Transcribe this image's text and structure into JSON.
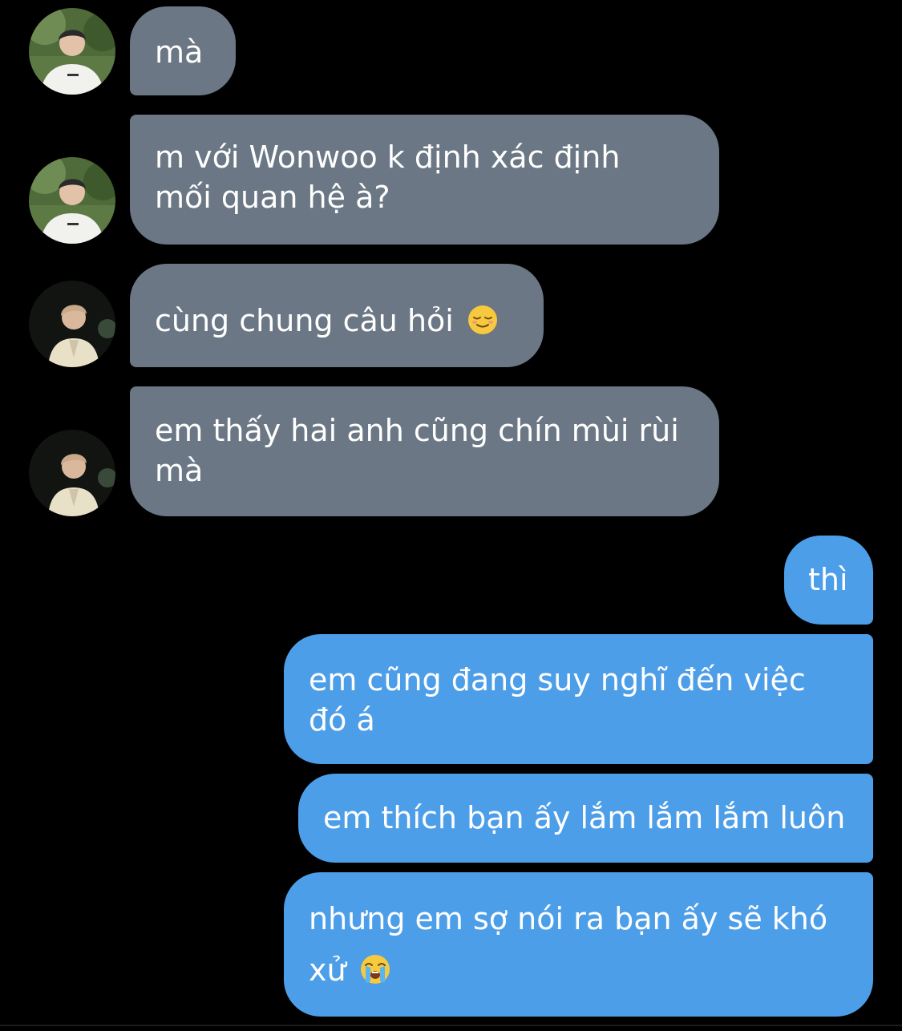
{
  "conversation": {
    "messages": [
      {
        "sender": "friend-1",
        "text": "mà"
      },
      {
        "sender": "friend-1",
        "text_lines": [
          "m với Wonwoo k định xác định",
          "mối quan hệ à?"
        ]
      },
      {
        "sender": "friend-2",
        "text": "cùng chung câu hỏi",
        "emoji": "relieved-face-emoji"
      },
      {
        "sender": "friend-2",
        "text_lines": [
          "em thấy hai anh cũng chín mùi rùi",
          "mà"
        ]
      },
      {
        "sender": "me",
        "text": "thì"
      },
      {
        "sender": "me",
        "text_lines": [
          "em cũng đang suy nghĩ đến việc",
          "đó á"
        ]
      },
      {
        "sender": "me",
        "text": "em thích bạn ấy lắm lắm lắm luôn"
      },
      {
        "sender": "me",
        "text_lines": [
          "nhưng em sợ nói ra bạn ấy sẽ khó",
          "xử"
        ],
        "emoji": "loudly-crying-face-emoji"
      }
    ]
  },
  "colors": {
    "background": "#000000",
    "incoming_bubble": "#6b7784",
    "outgoing_bubble": "#4d9ee8",
    "text": "#ffffff"
  }
}
